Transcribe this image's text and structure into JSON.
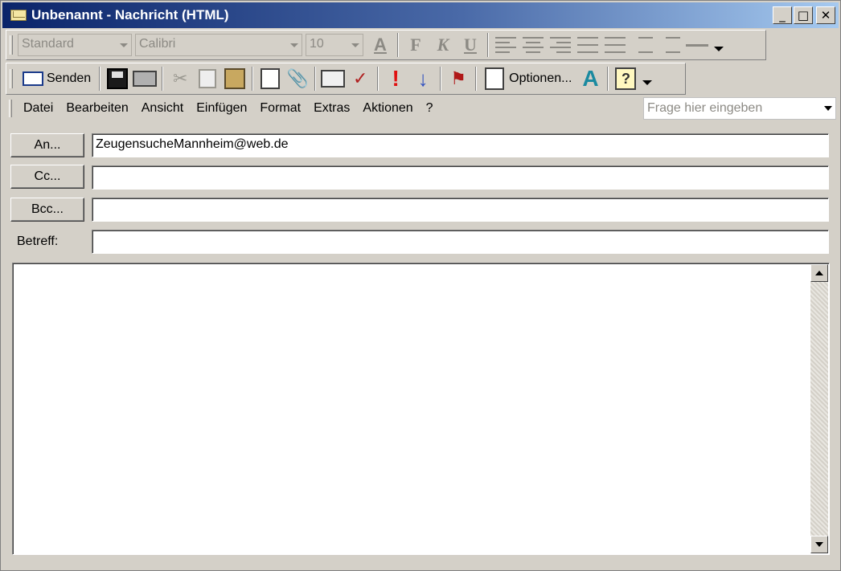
{
  "window": {
    "title": "Unbenannt - Nachricht (HTML)",
    "controls": {
      "minimize": "_",
      "maximize": "□",
      "close": "✕"
    }
  },
  "format_toolbar": {
    "style_value": "Standard",
    "font_value": "Calibri",
    "size_value": "10",
    "icons": [
      "font-color-icon",
      "bold-icon",
      "italic-icon",
      "underline-icon",
      "align-left-icon",
      "align-center-icon",
      "align-right-icon",
      "bullets-icon",
      "numbering-icon",
      "decrease-indent-icon",
      "increase-indent-icon",
      "horizontal-line-icon"
    ],
    "bold_label": "F",
    "italic_label": "K",
    "underline_label": "U",
    "font_color_label": "A"
  },
  "standard_toolbar": {
    "send_label": "Senden",
    "options_label": "Optionen...",
    "icons": [
      "save-icon",
      "print-icon",
      "cut-icon",
      "copy-icon",
      "paste-icon",
      "signature-icon",
      "attach-icon",
      "address-book-icon",
      "check-names-icon",
      "importance-high-icon",
      "importance-low-icon",
      "follow-up-flag-icon",
      "options-icon",
      "format-text-icon",
      "help-icon"
    ]
  },
  "menu": {
    "items": [
      "Datei",
      "Bearbeiten",
      "Ansicht",
      "Einfügen",
      "Format",
      "Extras",
      "Aktionen",
      "?"
    ],
    "help_placeholder": "Frage hier eingeben"
  },
  "address": {
    "to_button": "An...",
    "cc_button": "Cc...",
    "bcc_button": "Bcc...",
    "subject_label": "Betreff:",
    "to_value": "ZeugensucheMannheim@web.de",
    "cc_value": "",
    "bcc_value": "",
    "subject_value": ""
  },
  "colors": {
    "title_gradient_start": "#0a246a",
    "title_gradient_end": "#a6caf0",
    "face": "#d4d0c8",
    "importance_high": "#e01010",
    "importance_low": "#3050c0"
  }
}
